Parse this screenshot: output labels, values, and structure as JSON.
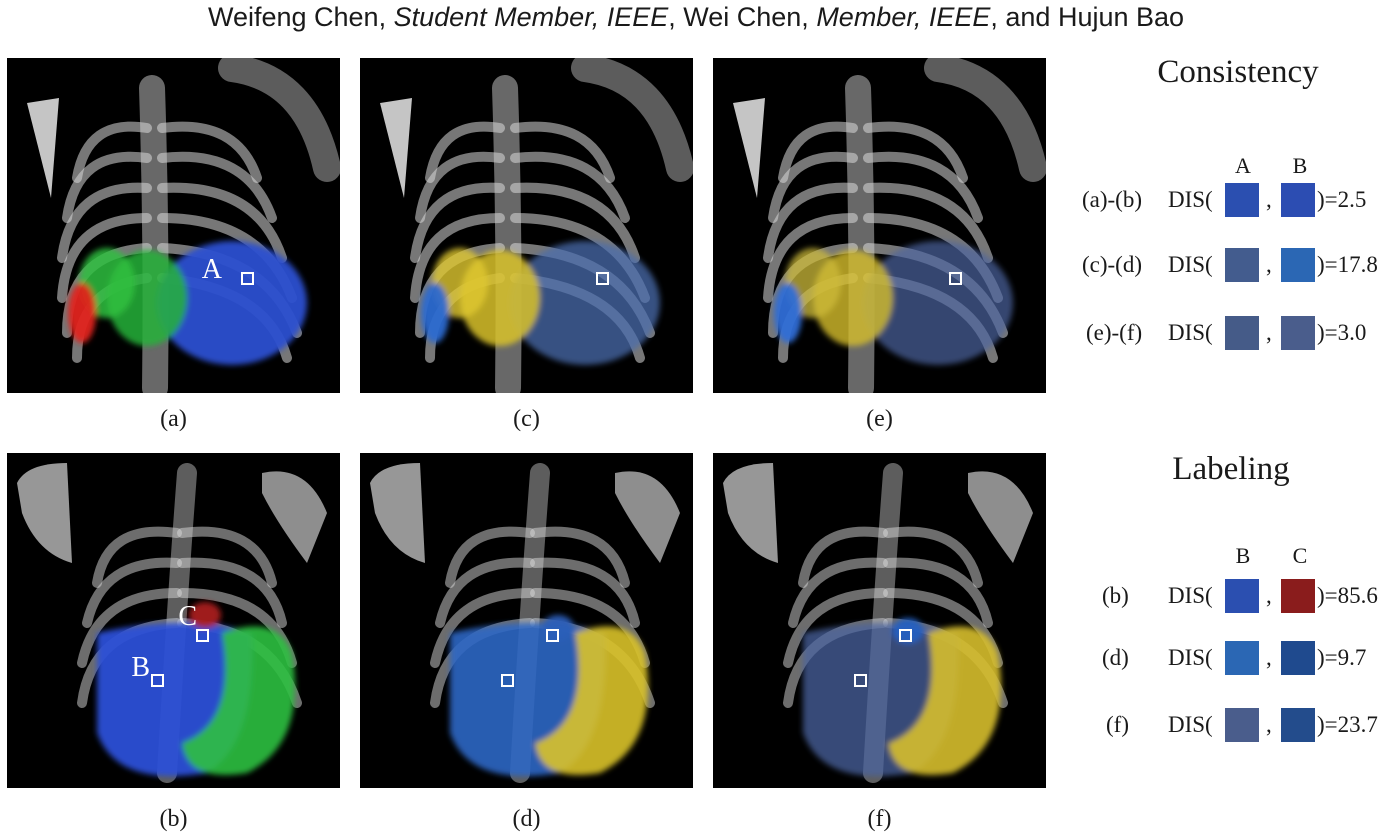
{
  "header": {
    "author1": "Weifeng Chen, ",
    "role1": "Student Member, IEEE",
    "author2": ", Wei Chen, ",
    "role2": "Member, IEEE",
    "author3": ", and Hujun Bao"
  },
  "panels": {
    "a": {
      "caption": "(a)",
      "marker": "A",
      "scheme": "rgb"
    },
    "c": {
      "caption": "(c)",
      "scheme": "blue-yellow"
    },
    "e": {
      "caption": "(e)",
      "scheme": "blue-yellow-faded"
    },
    "b": {
      "caption": "(b)",
      "marker1": "B",
      "marker2": "C",
      "scheme": "rgb"
    },
    "d": {
      "caption": "(d)",
      "scheme": "blue-yellow"
    },
    "f": {
      "caption": "(f)",
      "scheme": "blue-yellow-faded"
    }
  },
  "consistency": {
    "title": "Consistency",
    "col1": "A",
    "col2": "B",
    "rows": [
      {
        "label": "(a)-(b)",
        "dis": "DIS(",
        "comma": ",",
        "color1": "#2b4fb0",
        "color2": "#2c4db2",
        "value": ")=2.5"
      },
      {
        "label": "(c)-(d)",
        "dis": "DIS(",
        "comma": ",",
        "color1": "#435c8e",
        "color2": "#2b67b4",
        "value": ")=17.8"
      },
      {
        "label": "(e)-(f)",
        "dis": "DIS(",
        "comma": ",",
        "color1": "#455b88",
        "color2": "#4a5d8c",
        "value": ")=3.0"
      }
    ]
  },
  "labeling": {
    "title": "Labeling",
    "col1": "B",
    "col2": "C",
    "rows": [
      {
        "label": "(b)",
        "dis": "DIS(",
        "comma": ",",
        "color1": "#2b4fb0",
        "color2": "#8a1c1c",
        "value": ")=85.6"
      },
      {
        "label": "(d)",
        "dis": "DIS(",
        "comma": ",",
        "color1": "#2b67b4",
        "color2": "#1f4a8e",
        "value": ")=9.7"
      },
      {
        "label": "(f)",
        "dis": "DIS(",
        "comma": ",",
        "color1": "#4a5d8c",
        "color2": "#234c8c",
        "value": ")=23.7"
      }
    ]
  }
}
